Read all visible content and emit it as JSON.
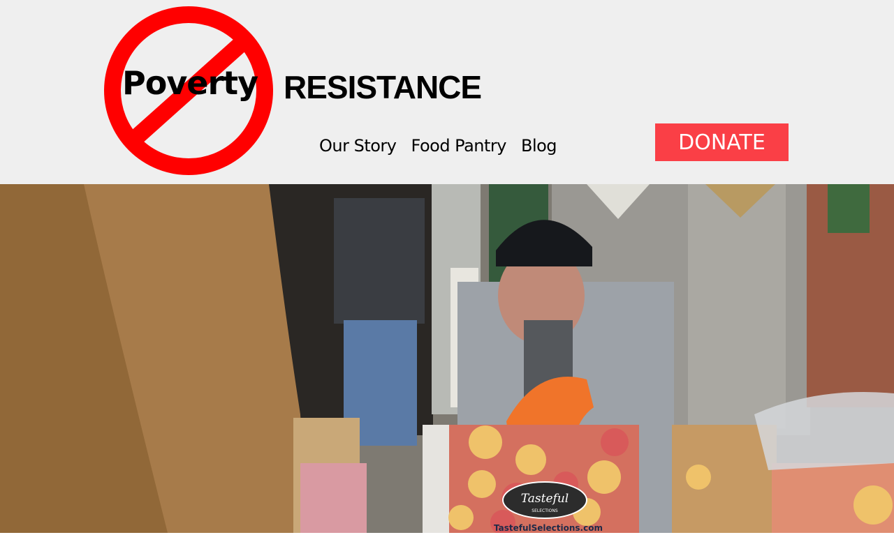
{
  "brand": {
    "logo_word": "Poverty",
    "title": "RESISTANCE",
    "icon": "no-symbol-icon",
    "logo_color": "#ff0000"
  },
  "nav": {
    "items": [
      {
        "label": "Our Story"
      },
      {
        "label": "Food Pantry"
      },
      {
        "label": "Blog"
      }
    ]
  },
  "donate": {
    "label": "DONATE",
    "color": "#fa3f46"
  },
  "hero": {
    "box_brand": "Tasteful",
    "box_brand_sub": "SELECTIONS",
    "box_url": "TastefulSelections.com"
  }
}
